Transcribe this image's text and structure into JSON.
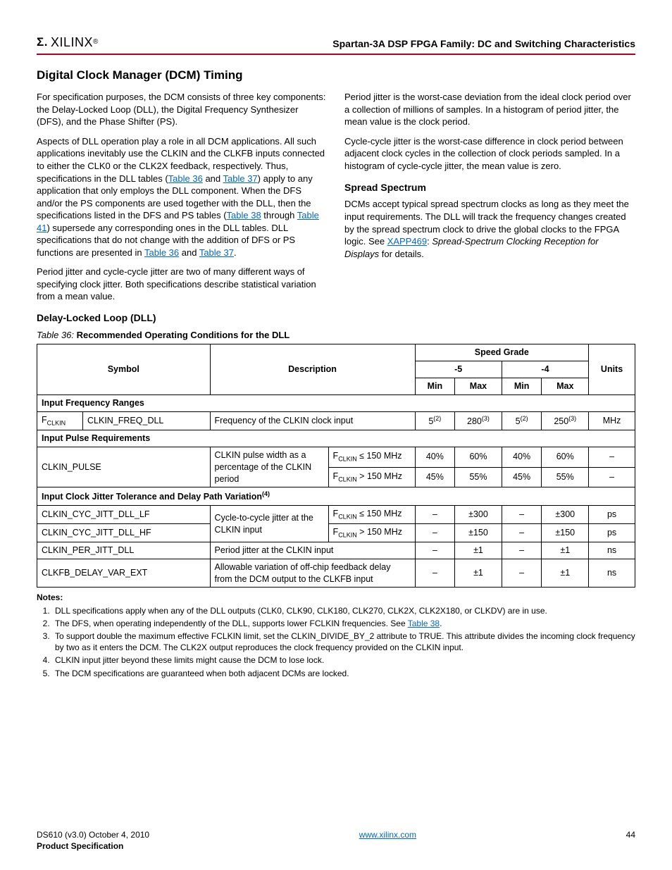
{
  "header": {
    "logo_text": "XILINX",
    "doc_title": "Spartan-3A DSP FPGA Family: DC and Switching Characteristics"
  },
  "h1": "Digital Clock Manager (DCM) Timing",
  "col1": {
    "p1a": "For specification purposes, the DCM consists of three key components: the Delay-Locked Loop (DLL), the Digital Frequency Synthesizer (DFS), and the Phase Shifter (PS).",
    "p2a": "Aspects of DLL operation play a role in all DCM applications. All such applications inevitably use the CLKIN and the CLKFB inputs connected to either the CLK0 or the CLK2X feedback, respectively. Thus, specifications in the DLL tables (",
    "p2_link1": "Table 36",
    "p2b": " and ",
    "p2_link2": "Table 37",
    "p2c": ") apply to any application that only employs the DLL component. When the DFS and/or the PS components are used together with the DLL, then the specifications listed in the DFS and PS tables (",
    "p2_link3": "Table 38",
    "p2d": " through ",
    "p2_link4": "Table 41",
    "p2e": ") supersede any corresponding ones in the DLL tables. DLL specifications that do not change with the addition of DFS or PS functions are presented in ",
    "p2_link5": "Table 36",
    "p2f": " and ",
    "p2_link6": "Table 37",
    "p2g": ".",
    "p3": "Period jitter and cycle-cycle jitter are two of many different ways of specifying clock jitter. Both specifications describe statistical variation from a mean value."
  },
  "col2": {
    "p1": "Period jitter is the worst-case deviation from the ideal clock period over a collection of millions of samples. In a histogram of period jitter, the mean value is the clock period.",
    "p2": "Cycle-cycle jitter is the worst-case difference in clock period between adjacent clock cycles in the collection of clock periods sampled. In a histogram of cycle-cycle jitter, the mean value is zero.",
    "h2": "Spread Spectrum",
    "p3a": "DCMs accept typical spread spectrum clocks as long as they meet the input requirements. The DLL will track the frequency changes created by the spread spectrum clock to drive the global clocks to the FPGA logic. See ",
    "p3_link": "XAPP469",
    "p3b": ": ",
    "p3_italic": "Spread-Spectrum Clocking Reception for Displays",
    "p3c": " for details."
  },
  "dll_heading": "Delay-Locked Loop (DLL)",
  "table_caption_num": "Table  36:",
  "table_caption_title": "  Recommended Operating Conditions for the DLL",
  "th": {
    "symbol": "Symbol",
    "description": "Description",
    "speed_grade": "Speed Grade",
    "units": "Units",
    "m5": "-5",
    "m4": "-4",
    "min": "Min",
    "max": "Max"
  },
  "sections": {
    "s1": "Input Frequency Ranges",
    "s2": "Input Pulse Requirements",
    "s3a": "Input Clock Jitter Tolerance and Delay Path Variation",
    "s3_sup": "(4)"
  },
  "rows": {
    "r1": {
      "sym_a": "F",
      "sym_a_sub": "CLKIN",
      "sym_b": "CLKIN_FREQ_DLL",
      "desc": "Frequency of the CLKIN clock input",
      "m5min": "5",
      "m5min_sup": "(2)",
      "m5max": "280",
      "m5max_sup": "(3)",
      "m4min": "5",
      "m4min_sup": "(2)",
      "m4max": "250",
      "m4max_sup": "(3)",
      "units": "MHz"
    },
    "r2": {
      "sym": "CLKIN_PULSE",
      "desc": "CLKIN pulse width as a percentage of the CLKIN period",
      "cond1_a": "F",
      "cond1_sub": "CLKIN",
      "cond1_b": " ≤ 150 MHz",
      "cond2_a": "F",
      "cond2_sub": "CLKIN",
      "cond2_b": " > 150 MHz",
      "a_m5min": "40%",
      "a_m5max": "60%",
      "a_m4min": "40%",
      "a_m4max": "60%",
      "a_units": "–",
      "b_m5min": "45%",
      "b_m5max": "55%",
      "b_m4min": "45%",
      "b_m4max": "55%",
      "b_units": "–"
    },
    "r3": {
      "sym": "CLKIN_CYC_JITT_DLL_LF",
      "desc": "Cycle-to-cycle jitter at the CLKIN input",
      "cond_a": "F",
      "cond_sub": "CLKIN",
      "cond_b": " ≤ 150 MHz",
      "m5min": "–",
      "m5max": "±300",
      "m4min": "–",
      "m4max": "±300",
      "units": "ps"
    },
    "r4": {
      "sym": "CLKIN_CYC_JITT_DLL_HF",
      "cond_a": "F",
      "cond_sub": "CLKIN",
      "cond_b": " > 150 MHz",
      "m5min": "–",
      "m5max": "±150",
      "m4min": "–",
      "m4max": "±150",
      "units": "ps"
    },
    "r5": {
      "sym": "CLKIN_PER_JITT_DLL",
      "desc": "Period jitter at the CLKIN input",
      "m5min": "–",
      "m5max": "±1",
      "m4min": "–",
      "m4max": "±1",
      "units": "ns"
    },
    "r6": {
      "sym": "CLKFB_DELAY_VAR_EXT",
      "desc": "Allowable variation of off-chip feedback delay from the DCM output to the CLKFB input",
      "m5min": "–",
      "m5max": "±1",
      "m4min": "–",
      "m4max": "±1",
      "units": "ns"
    }
  },
  "notes_title": "Notes:",
  "notes": {
    "n1": "DLL specifications apply when any of the DLL outputs (CLK0, CLK90, CLK180, CLK270, CLK2X, CLK2X180, or CLKDV) are in use.",
    "n2a": "The DFS, when operating independently of the DLL, supports lower FCLKIN frequencies. See ",
    "n2_link": "Table 38",
    "n2b": ".",
    "n3": "To support double the maximum effective FCLKIN limit, set the CLKIN_DIVIDE_BY_2 attribute to TRUE. This attribute divides the incoming clock frequency by two as it enters the DCM. The CLK2X output reproduces the clock frequency provided on the CLKIN input.",
    "n4": "CLKIN input jitter beyond these limits might cause the DCM to lose lock.",
    "n5": "The DCM specifications are guaranteed when both adjacent DCMs are locked."
  },
  "footer": {
    "left1": "DS610 (v3.0) October 4, 2010",
    "left2": "Product Specification",
    "center": "www.xilinx.com",
    "right": "44"
  }
}
